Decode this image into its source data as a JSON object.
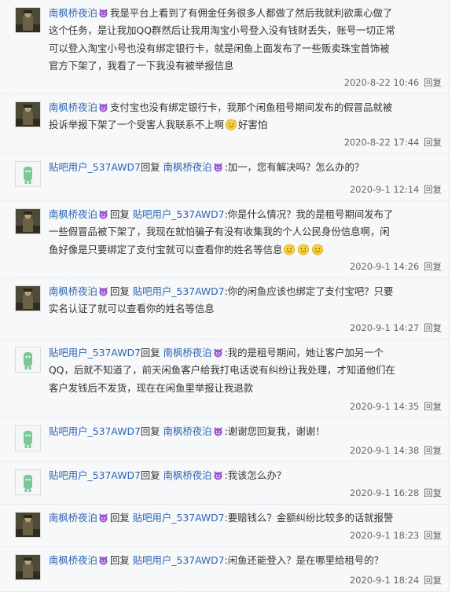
{
  "labels": {
    "reply_prefix": "回复",
    "reply_link": "回复"
  },
  "users": {
    "a": "南枫桥夜泊",
    "b": "贴吧用户_537AWD7"
  },
  "badge_icon": "purple-devil-emoji",
  "emoji_icon": "sweat-face-emoji",
  "posts": [
    {
      "author": "南枫桥夜泊",
      "avatar": "soldier-photo-avatar",
      "reply_to": "",
      "lines": [
        "我是平台上看到了有佣金任务很多人都做了然后我就利欲熏心做了",
        "这个任务，是让我加QQ群然后让我用淘宝小号登入没有钱财丢失，账号一切正常",
        "可以登入淘宝小号也没有绑定银行卡，就是闲鱼上面发布了一些贩卖珠宝首饰被",
        "官方下架了，我看了一下我没有被举报信息"
      ],
      "time": "2020-8-22 10:46"
    },
    {
      "author": "南枫桥夜泊",
      "avatar": "soldier-photo-avatar",
      "reply_to": "",
      "lines": [
        "支付宝也没有绑定银行卡，我那个闲鱼租号期间发布的假冒品就被",
        "投诉举报下架了一个受害人我联系不上啊",
        "好害怕"
      ],
      "emoji_count": 1,
      "time": "2020-8-22 17:44"
    },
    {
      "author": "贴吧用户_537AWD7",
      "avatar": "default-tieba-avatar",
      "reply_to": "南枫桥夜泊",
      "lines": [
        ":加一，您有解决吗？怎么办的？"
      ],
      "time": "2020-9-1 12:14"
    },
    {
      "author": "南枫桥夜泊",
      "avatar": "soldier-photo-avatar",
      "reply_to": "贴吧用户_537AWD7",
      "lines": [
        ":你是什么情况？我的是租号期间发布了",
        "一些假冒品被下架了，我现在就怕骗子有没有收集我的个人公民身份信息啊，闲",
        "鱼好像是只要绑定了支付宝就可以查看你的姓名等信息"
      ],
      "emoji_count": 3,
      "time": "2020-9-1 14:26"
    },
    {
      "author": "南枫桥夜泊",
      "avatar": "soldier-photo-avatar",
      "reply_to": "贴吧用户_537AWD7",
      "lines": [
        ":你的闲鱼应该也绑定了支付宝吧？只要",
        "实名认证了就可以查看你的姓名等信息"
      ],
      "time": "2020-9-1 14:27"
    },
    {
      "author": "贴吧用户_537AWD7",
      "avatar": "default-tieba-avatar",
      "reply_to": "南枫桥夜泊",
      "lines": [
        ":我的是租号期间，她让客户加另一个",
        "QQ，后就不知道了，前天闲鱼客户给我打电话说有纠纷让我处理，才知道他们在",
        "客户发钱后不发货，现在在闲鱼里举报让我退款"
      ],
      "time": "2020-9-1 14:35"
    },
    {
      "author": "贴吧用户_537AWD7",
      "avatar": "default-tieba-avatar",
      "reply_to": "南枫桥夜泊",
      "lines": [
        ":谢谢您回复我，谢谢！"
      ],
      "time": "2020-9-1 14:38"
    },
    {
      "author": "贴吧用户_537AWD7",
      "avatar": "default-tieba-avatar",
      "reply_to": "南枫桥夜泊",
      "lines": [
        ":我该怎么办？"
      ],
      "time": "2020-9-1 16:28"
    },
    {
      "author": "南枫桥夜泊",
      "avatar": "soldier-photo-avatar",
      "reply_to": "贴吧用户_537AWD7",
      "lines": [
        ":要赔钱么？金额纠纷比较多的话就报警"
      ],
      "time": "2020-9-1 18:23"
    },
    {
      "author": "南枫桥夜泊",
      "avatar": "soldier-photo-avatar",
      "reply_to": "贴吧用户_537AWD7",
      "lines": [
        ":闲鱼还能登入？是在哪里给租号的？"
      ],
      "time": "2020-9-1 18:24"
    }
  ]
}
